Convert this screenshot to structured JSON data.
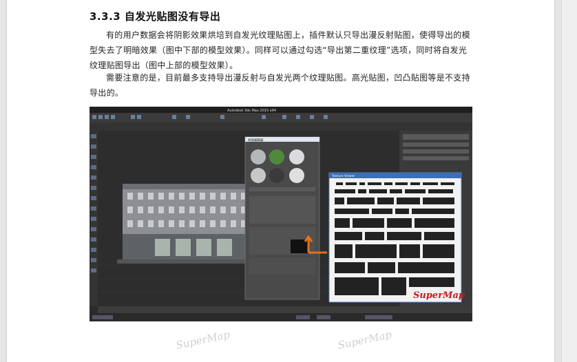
{
  "document": {
    "heading": "3.3.3 自发光贴图没有导出",
    "paragraphs": [
      "有的用户数据会将阴影效果烘培到自发光纹理贴图上，插件默认只导出漫反射贴图，使得导出的模型失去了明暗效果（图中下部的模型效果）。同样可以通过勾选“导出第二重纹理”选项，同时将自发光纹理贴图导出（图中上部的模型效果）。",
      "需要注意的是，目前最多支持导出漫反射与自发光两个纹理贴图。高光贴图，凹凸贴图等是不支持导出的。"
    ]
  },
  "figure": {
    "window_title": "Autodesk 3ds Max 2015 x64",
    "material_editor_title": "材质编辑器",
    "texture_viewer_title": "Texture Viewer",
    "watermark_text": "SuperMap",
    "colors": {
      "viewport_bg": "#2d2d2d",
      "toolbar": "#3c3c3c",
      "accent_arrow": "#e8701a",
      "watermark_red": "#c8171b",
      "texture_bg": "#f2f2f2"
    }
  },
  "watermarks": [
    "SuperMap",
    "SuperMap"
  ]
}
